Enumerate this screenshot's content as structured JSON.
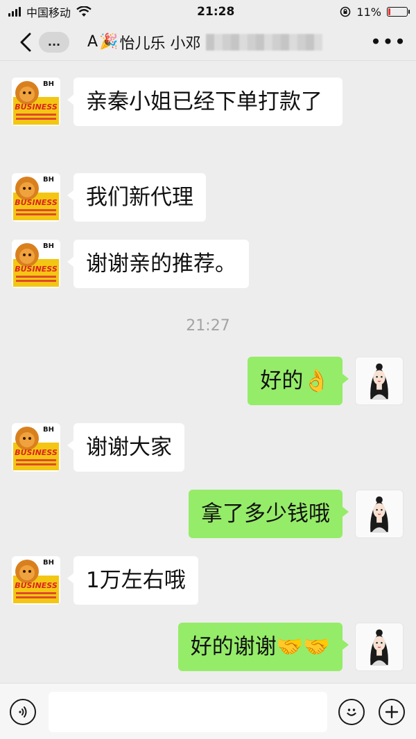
{
  "status_bar": {
    "carrier": "中国移动",
    "time": "21:28",
    "battery_percent": "11%",
    "battery_level": 0.11,
    "battery_color": "#e33333"
  },
  "header": {
    "title_prefix": "A",
    "title_emoji": "🎉",
    "title_name": "怡儿乐 小邓",
    "more_label": "...",
    "menu_label": "•••"
  },
  "messages": [
    {
      "side": "in",
      "text": "亲秦小姐已经下单打款了"
    },
    {
      "side": "in",
      "text": "我们新代理"
    },
    {
      "side": "in",
      "text": "谢谢亲的推荐。"
    },
    {
      "timestamp": "21:27"
    },
    {
      "side": "out",
      "text": "好的👌"
    },
    {
      "side": "in",
      "text": "谢谢大家"
    },
    {
      "side": "out",
      "text": "拿了多少钱哦"
    },
    {
      "side": "in",
      "text": "1万左右哦"
    },
    {
      "side": "out",
      "text": "好的谢谢🤝🤝"
    }
  ],
  "avatars": {
    "left": {
      "brand": "BH",
      "banner": "BUSINESS"
    }
  },
  "colors": {
    "outgoing_bubble": "#95ec69",
    "incoming_bubble": "#ffffff",
    "background": "#ededed"
  },
  "icons": {
    "voice": "voice-icon",
    "emoji": "emoji-icon",
    "plus": "plus-icon",
    "back": "chevron-left-icon",
    "wifi": "wifi-icon",
    "signal": "signal-icon",
    "battery": "battery-icon"
  }
}
